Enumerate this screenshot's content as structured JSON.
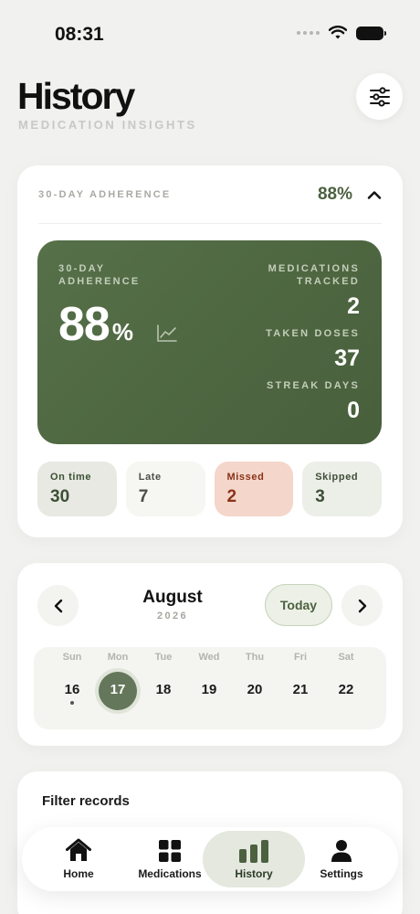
{
  "status_bar": {
    "time": "08:31"
  },
  "header": {
    "title": "History",
    "subtitle": "MEDICATION INSIGHTS"
  },
  "adherence_card": {
    "header_label": "30-DAY ADHERENCE",
    "header_value": "88%",
    "panel": {
      "label": "30-DAY ADHERENCE",
      "value": "88",
      "unit": "%",
      "stats": [
        {
          "label": "MEDICATIONS TRACKED",
          "value": "2"
        },
        {
          "label": "TAKEN DOSES",
          "value": "37"
        },
        {
          "label": "STREAK DAYS",
          "value": "0"
        }
      ]
    },
    "pills": [
      {
        "label": "On time",
        "value": "30"
      },
      {
        "label": "Late",
        "value": "7"
      },
      {
        "label": "Missed",
        "value": "2"
      },
      {
        "label": "Skipped",
        "value": "3"
      }
    ]
  },
  "calendar": {
    "month": "August",
    "year": "2026",
    "today_label": "Today",
    "days": [
      {
        "name": "Sun",
        "num": "16"
      },
      {
        "name": "Mon",
        "num": "17"
      },
      {
        "name": "Tue",
        "num": "18"
      },
      {
        "name": "Wed",
        "num": "19"
      },
      {
        "name": "Thu",
        "num": "20"
      },
      {
        "name": "Fri",
        "num": "21"
      },
      {
        "name": "Sat",
        "num": "22"
      }
    ]
  },
  "filter": {
    "title": "Filter records"
  },
  "tabs": [
    {
      "label": "Home"
    },
    {
      "label": "Medications"
    },
    {
      "label": "History"
    },
    {
      "label": "Settings"
    }
  ],
  "colors": {
    "accent_green": "#56704a",
    "missed_red": "#8a3318",
    "background": "#f1f1ef"
  }
}
